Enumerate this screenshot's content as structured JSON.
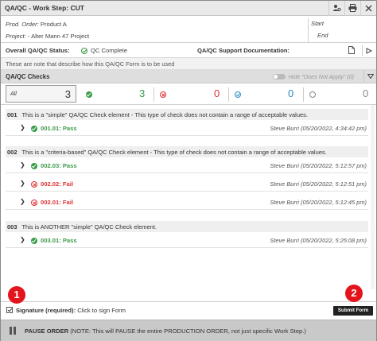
{
  "window": {
    "title": "QA/QC - Work Step: CUT",
    "icons": [
      "person-settings-icon",
      "print-icon",
      "close-icon"
    ]
  },
  "header": {
    "prod_order_label": "Prod. Order:",
    "prod_order_value": "Product A",
    "project_label": "Project:",
    "project_value": "- Alter Mann 47 Project",
    "start_label": "Start",
    "end_label": "End"
  },
  "status": {
    "overall_label": "Overall QA/QC Status:",
    "overall_value": "QC Complete",
    "support_label": "QA/QC Support Documentation:"
  },
  "note": "These are note that describe how this QA/QC Form is to be used",
  "checks": {
    "title": "QA/QC Checks",
    "hide_label": "Hide \"Does Not Apply\" (0)",
    "all_label": "All",
    "all_count": "3",
    "pass_count": "3",
    "fail_count": "0",
    "verified_count": "0",
    "na_count": "0"
  },
  "groups": [
    {
      "num": "001",
      "text": "This is a \"simple\" QA/QC Check element - This type of check does not contain a range of acceptable values.",
      "items": [
        {
          "label": "001.01: Pass",
          "status": "pass",
          "who": "Steve Burri (05/20/2022, 4:34:42 pm)"
        }
      ]
    },
    {
      "num": "002",
      "text": "This is a \"criteria-based\" QA/QC Check element - This type of check does not contain a range of acceptable values.",
      "items": [
        {
          "label": "002.03: Pass",
          "status": "pass",
          "who": "Steve Burri (05/20/2022, 5:12:57 pm)"
        },
        {
          "label": "002.02: Fail",
          "status": "fail",
          "who": "Steve Burri (05/20/2022, 5:12:51 pm)"
        },
        {
          "label": "002.01: Fail",
          "status": "fail",
          "who": "Steve Burri (05/20/2022, 5:12:45 pm)"
        }
      ]
    },
    {
      "num": "003",
      "text": "This is ANOTHER \"simple\" QA/QC Check element.",
      "items": [
        {
          "label": "003.01: Pass",
          "status": "pass",
          "who": "Steve Burri (05/20/2022, 5:25:08 pm)"
        }
      ]
    }
  ],
  "signature": {
    "label_bold": "Signature (required):",
    "label_rest": "Click to sign Form",
    "submit": "Submit Form"
  },
  "badges": [
    "1",
    "2"
  ],
  "pause": {
    "label_bold": "PAUSE ORDER",
    "label_rest": "(NOTE: This will PAUSE the entire PRODUCTION ORDER, not just specific Work Step.)"
  },
  "colors": {
    "pass": "#3a9a47",
    "fail": "#dd3333",
    "verified": "#2a8ec2",
    "badge": "#e3141b"
  }
}
